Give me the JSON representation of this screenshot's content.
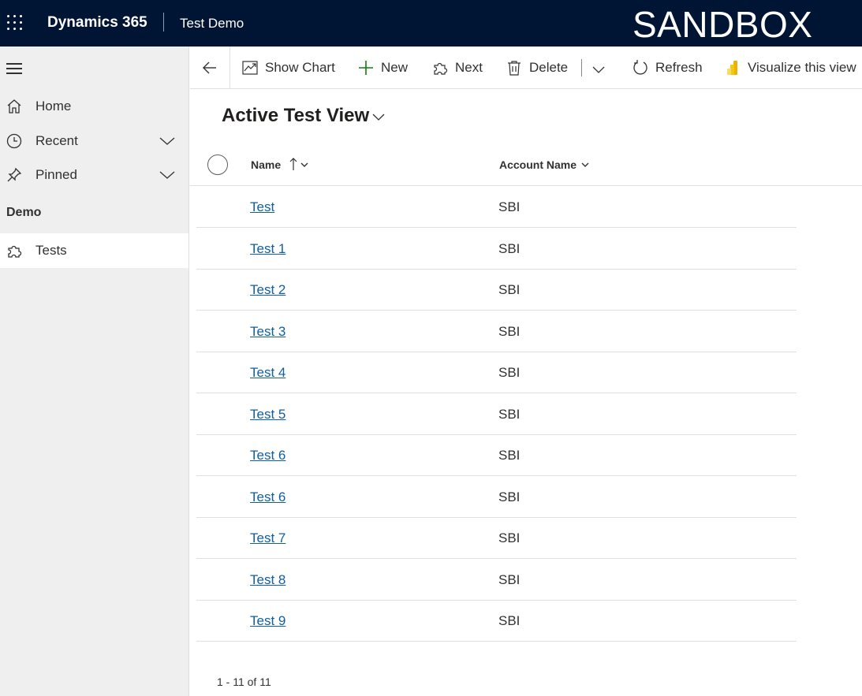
{
  "topbar": {
    "app_name": "Dynamics 365",
    "module": "Test Demo",
    "environment": "SANDBOX",
    "icon": "waffle-icon"
  },
  "sidebar": {
    "menu_icon": "hamburger-icon",
    "items": [
      {
        "label": "Home",
        "icon": "home-icon"
      },
      {
        "label": "Recent",
        "icon": "clock-icon",
        "expandable": true
      },
      {
        "label": "Pinned",
        "icon": "pin-icon",
        "expandable": true
      }
    ],
    "group": "Demo",
    "entities": [
      {
        "label": "Tests",
        "icon": "puzzle-icon",
        "selected": true
      }
    ]
  },
  "commandbar": {
    "back_icon": "back-arrow-icon",
    "commands": [
      {
        "label": "Show Chart",
        "icon": "chart-icon"
      },
      {
        "label": "New",
        "icon": "plus-icon"
      },
      {
        "label": "Next",
        "icon": "puzzle-icon"
      },
      {
        "label": "Delete",
        "icon": "trash-icon"
      },
      {
        "label": "Refresh",
        "icon": "refresh-icon"
      },
      {
        "label": "Visualize this view",
        "icon": "powerbi-icon"
      }
    ]
  },
  "view": {
    "title": "Active Test View"
  },
  "grid": {
    "columns": [
      "Name",
      "Account Name"
    ],
    "sort": {
      "column": "Name",
      "direction": "ascending"
    },
    "rows": [
      {
        "name": "Test",
        "account": "SBI"
      },
      {
        "name": "Test 1",
        "account": "SBI"
      },
      {
        "name": "Test 2",
        "account": "SBI"
      },
      {
        "name": "Test 3",
        "account": "SBI"
      },
      {
        "name": "Test 4",
        "account": "SBI"
      },
      {
        "name": "Test 5",
        "account": "SBI"
      },
      {
        "name": "Test 6",
        "account": "SBI"
      },
      {
        "name": "Test 6",
        "account": "SBI"
      },
      {
        "name": "Test 7",
        "account": "SBI"
      },
      {
        "name": "Test 8",
        "account": "SBI"
      },
      {
        "name": "Test 9",
        "account": "SBI"
      }
    ],
    "footer": "1 - 11 of 11"
  },
  "colors": {
    "topbar": "#001433",
    "link": "#115ea3",
    "sidebar": "#efefef",
    "new_icon": "#107c10"
  }
}
